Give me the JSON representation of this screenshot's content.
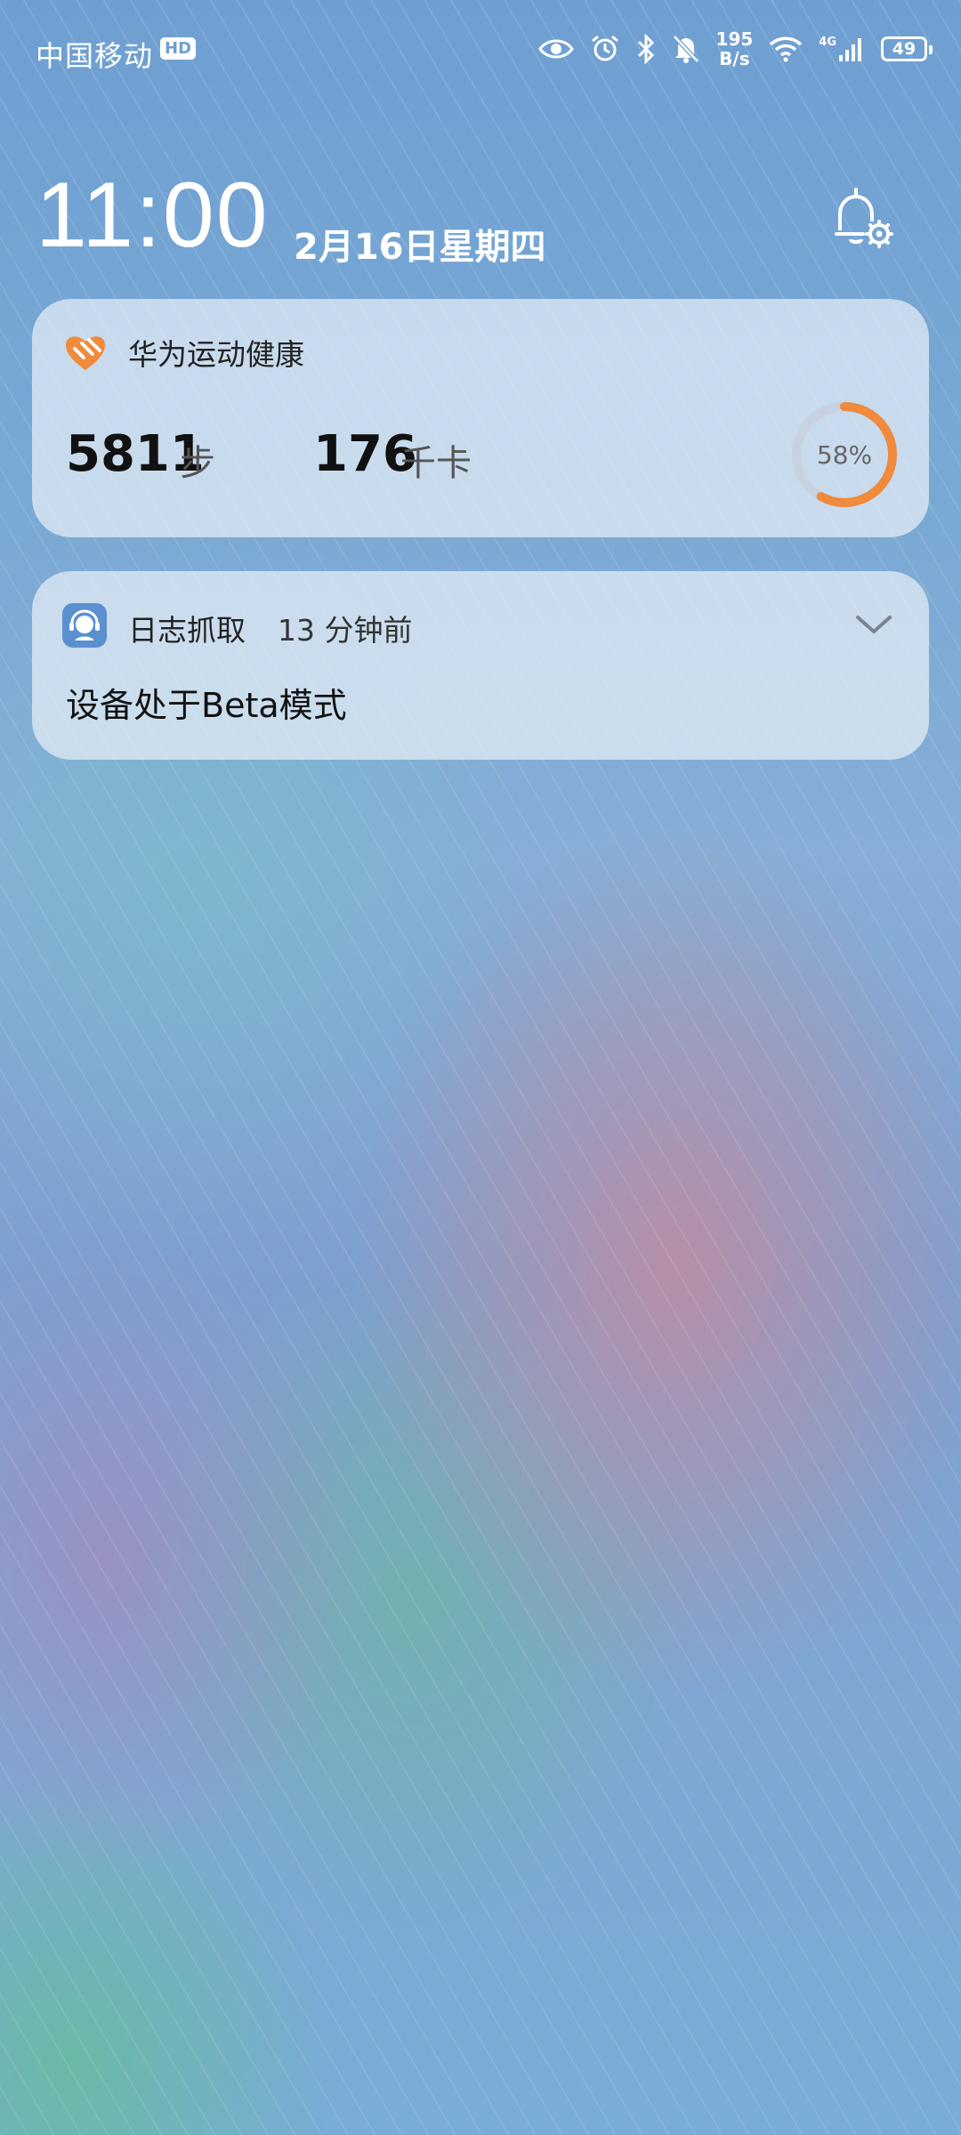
{
  "status_bar": {
    "carrier": "中国移动",
    "hd_badge": "HD",
    "network_speed_value": "195",
    "network_speed_unit": "B/s",
    "network_type": "4G",
    "battery_level": "49",
    "icons": [
      "eye-icon",
      "alarm-icon",
      "bluetooth-icon",
      "bell-muted-icon",
      "wifi-icon",
      "signal-icon",
      "battery-icon"
    ]
  },
  "lockscreen": {
    "time": "11:00",
    "date": "2月16日星期四"
  },
  "health_card": {
    "app_name": "华为运动健康",
    "steps_value": "5811",
    "steps_unit": "步",
    "calories_value": "176",
    "calories_unit": "千卡",
    "progress_label": "58%",
    "progress_fraction": 0.58,
    "accent_color": "#f08a3c"
  },
  "log_card": {
    "app_name": "日志抓取",
    "time_ago": "13 分钟前",
    "message": "设备处于Beta模式"
  }
}
